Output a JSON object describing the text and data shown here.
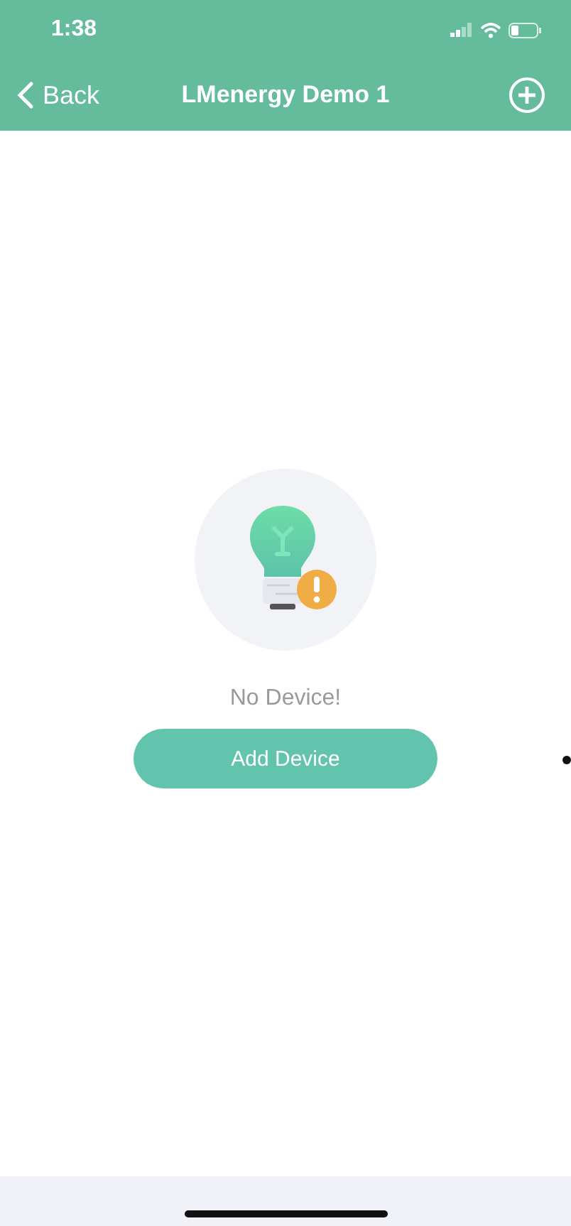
{
  "status_bar": {
    "time": "1:38"
  },
  "nav_bar": {
    "back_label": "Back",
    "title": "LMenergy Demo 1"
  },
  "empty_state": {
    "message": "No Device!",
    "button": "Add Device"
  }
}
